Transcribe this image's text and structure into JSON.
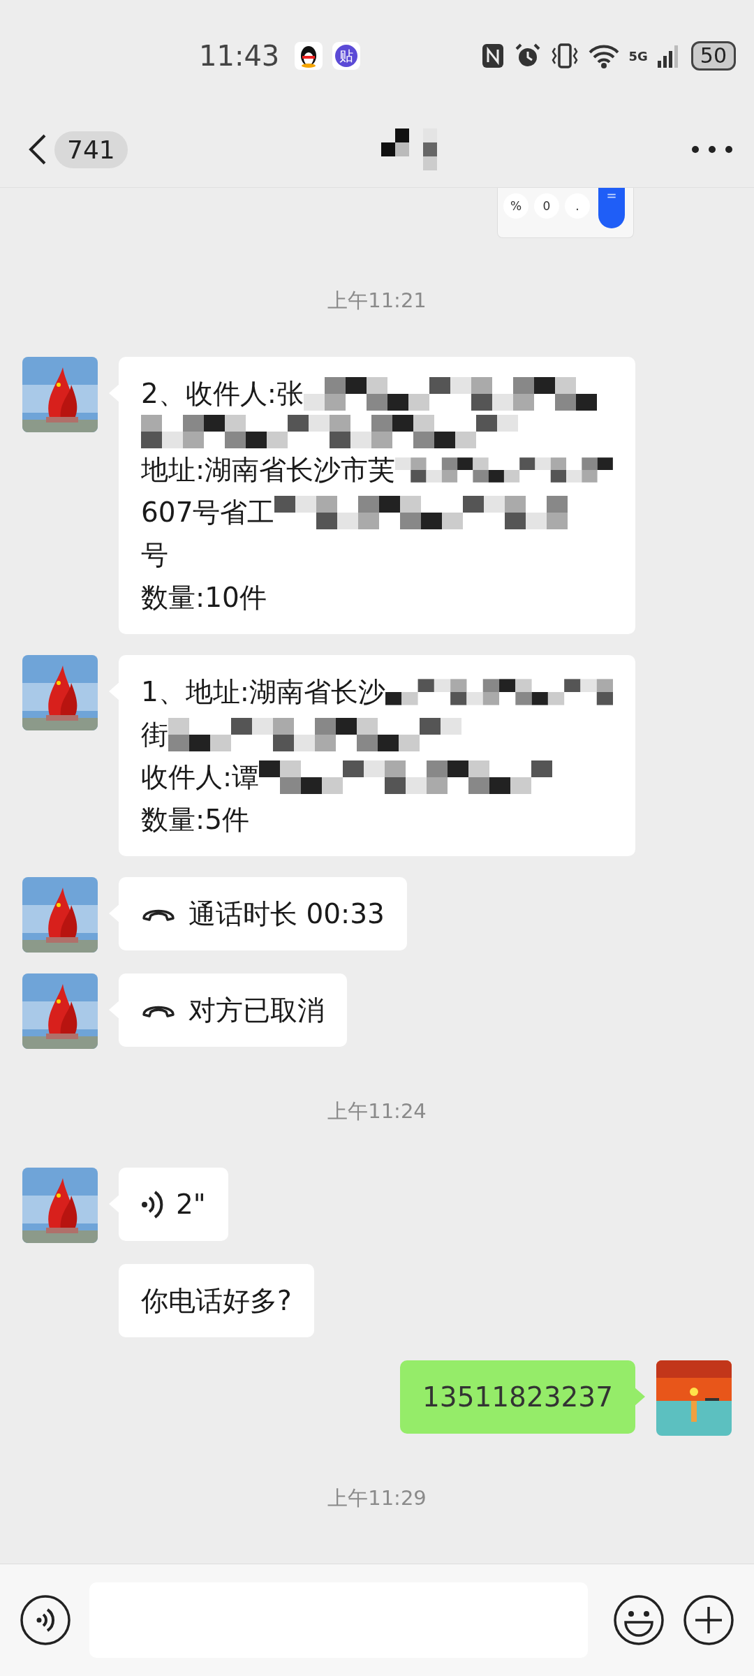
{
  "status_bar": {
    "time": "11:43",
    "app_icon_text": "贴",
    "network": "5G",
    "battery": "50"
  },
  "header": {
    "back_count": "741"
  },
  "calculator_keys": [
    "%",
    "0",
    ".",
    "="
  ],
  "messages": [
    {
      "kind": "timestamp",
      "text": "上午11:21"
    },
    {
      "kind": "text",
      "outgoing": false,
      "lines": [
        {
          "text": "2、收件人:张",
          "redacted": true
        },
        {
          "redacted": true
        },
        {
          "text": "地址:湖南省长沙市芙",
          "redacted": true
        },
        {
          "text": "607号省工",
          "redacted": true
        },
        {
          "text": "号",
          "redacted": false
        },
        {
          "text": "数量:10件",
          "redacted": false
        }
      ]
    },
    {
      "kind": "text",
      "outgoing": false,
      "lines": [
        {
          "text": "1、地址:湖南省长沙",
          "redacted": true
        },
        {
          "text": "街",
          "redacted": true
        },
        {
          "text": "收件人:谭",
          "redacted": true
        },
        {
          "text": "数量:5件",
          "redacted": false
        }
      ]
    },
    {
      "kind": "call",
      "outgoing": false,
      "text": "通话时长 00:33"
    },
    {
      "kind": "call",
      "outgoing": false,
      "text": "对方已取消"
    },
    {
      "kind": "timestamp",
      "text": "上午11:24"
    },
    {
      "kind": "voice",
      "outgoing": false,
      "text": "2\""
    },
    {
      "kind": "text",
      "outgoing": false,
      "continued": true,
      "lines": [
        {
          "text": "你电话好多?",
          "redacted": false
        }
      ]
    },
    {
      "kind": "text",
      "outgoing": true,
      "lines": [
        {
          "text": "13511823237",
          "redacted": false
        }
      ]
    },
    {
      "kind": "timestamp",
      "text": "上午11:29"
    }
  ]
}
